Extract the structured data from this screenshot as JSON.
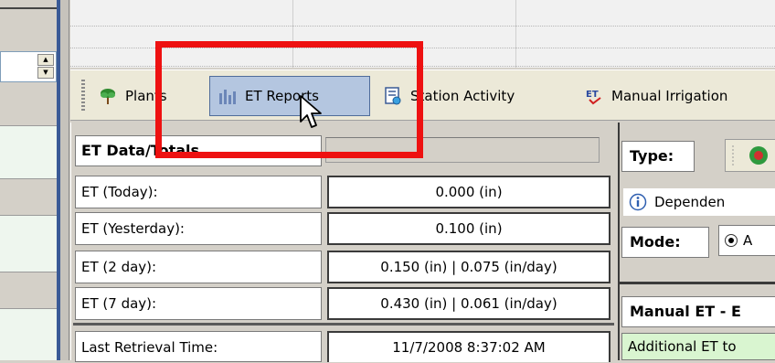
{
  "toolbar": {
    "items": [
      {
        "label": "Plants",
        "icon": "plant-icon"
      },
      {
        "label": "ET Reports",
        "icon": "bar-chart-icon",
        "active": true
      },
      {
        "label": "Station Activity",
        "icon": "station-activity-icon"
      },
      {
        "label": "Manual Irrigation",
        "icon": "et-manual-icon"
      }
    ]
  },
  "et_panel": {
    "title": "ET Data/Totals",
    "rows": [
      {
        "label": "ET (Today):",
        "value": "0.000 (in)"
      },
      {
        "label": "ET (Yesterday):",
        "value": "0.100 (in)"
      },
      {
        "label": "ET (2 day):",
        "value": "0.150 (in) | 0.075 (in/day)"
      },
      {
        "label": "ET (7 day):",
        "value": "0.430 (in) | 0.061 (in/day)"
      }
    ],
    "last_retrieval": {
      "label": "Last Retrieval Time:",
      "value": "11/7/2008 8:37:02 AM"
    }
  },
  "right_panel": {
    "type_label": "Type:",
    "dependent_text": "Dependen",
    "mode_label": "Mode:",
    "mode_value": "A",
    "manual_et_title": "Manual ET - E",
    "additional_text": "Additional  ET to"
  },
  "colors": {
    "highlight": "#ee1111",
    "active_button": "#b4c6e0",
    "additional_bg": "#d9f5d0"
  }
}
